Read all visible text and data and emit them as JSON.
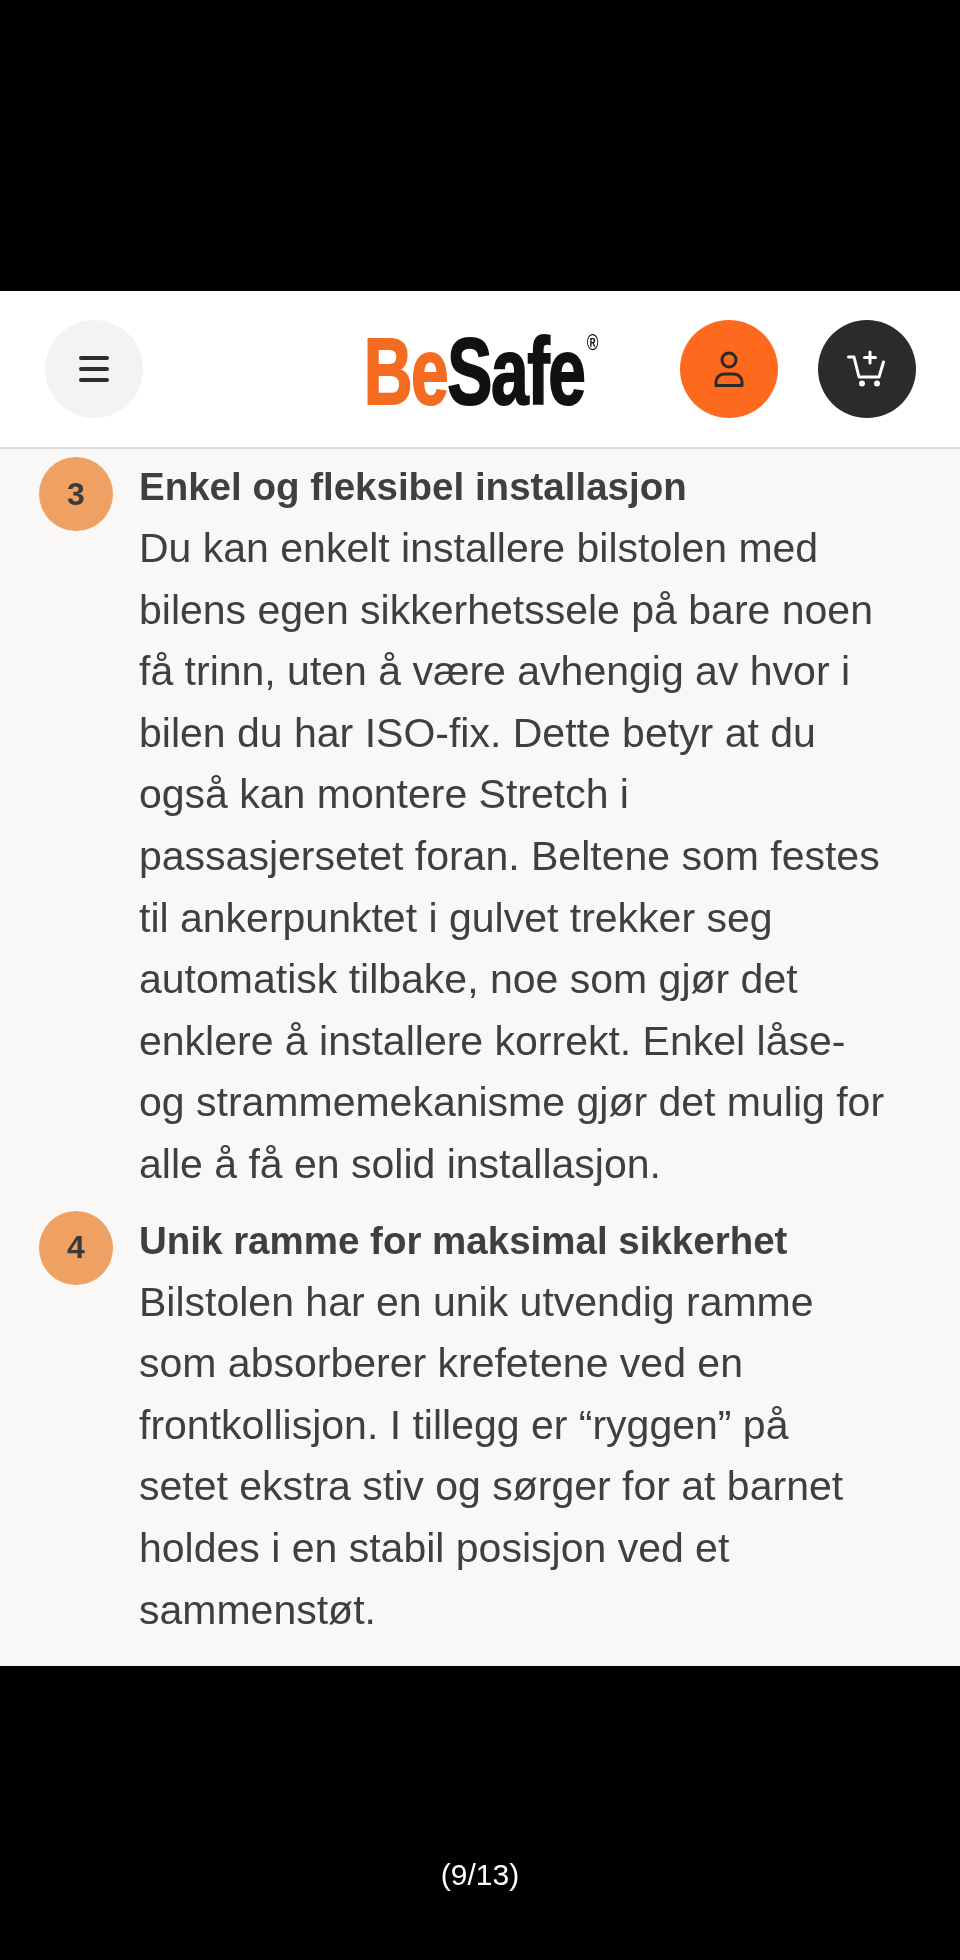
{
  "header": {
    "logo": {
      "parts": [
        {
          "text": "Be",
          "color": "#f36c21"
        },
        {
          "text": "Safe",
          "color": "#111111"
        }
      ],
      "mark": "®"
    }
  },
  "features": [
    {
      "number": "3",
      "title": "Enkel og fleksibel installasjon",
      "body": "Du kan enkelt installere bilstolen med bilens egen sikkerhetssele på bare noen få trinn, uten å være avhengig av hvor i bilen du har ISO-fix. Dette betyr at du også kan montere Stretch i passasjersetet foran. Beltene som festes til ankerpunktet i gulvet trekker seg automatisk tilbake, noe som gjør det enklere å installere korrekt. Enkel låse- og strammemekanisme gjør det mulig for alle å få en solid installasjon."
    },
    {
      "number": "4",
      "title": "Unik ramme for maksimal sikkerhet",
      "body": "Bilstolen har en unik utvendig ramme som absorberer krefetene ved en frontkollisjon. I tillegg er “ryggen” på setet ekstra stiv og sørger for at barnet holdes i en stabil posisjon ved et sammenstøt."
    }
  ],
  "page_indicator": "(9/13)"
}
